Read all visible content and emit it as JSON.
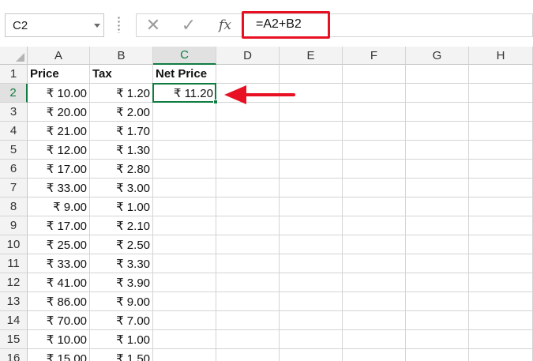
{
  "formula_bar": {
    "name_box": "C2",
    "formula": "=A2+B2",
    "fx_label": "fx"
  },
  "columns": [
    "A",
    "B",
    "C",
    "D",
    "E",
    "F",
    "G",
    "H"
  ],
  "rows": [
    "1",
    "2",
    "3",
    "4",
    "5",
    "6",
    "7",
    "8",
    "9",
    "10",
    "11",
    "12",
    "13",
    "14",
    "15",
    "16"
  ],
  "headers": {
    "price": "Price",
    "tax": "Tax",
    "net_price": "Net Price"
  },
  "data": [
    {
      "price": "₹ 10.00",
      "tax": "₹ 1.20",
      "net": "₹ 11.20"
    },
    {
      "price": "₹ 20.00",
      "tax": "₹ 2.00",
      "net": ""
    },
    {
      "price": "₹ 21.00",
      "tax": "₹ 1.70",
      "net": ""
    },
    {
      "price": "₹ 12.00",
      "tax": "₹ 1.30",
      "net": ""
    },
    {
      "price": "₹ 17.00",
      "tax": "₹ 2.80",
      "net": ""
    },
    {
      "price": "₹ 33.00",
      "tax": "₹ 3.00",
      "net": ""
    },
    {
      "price": "₹ 9.00",
      "tax": "₹ 1.00",
      "net": ""
    },
    {
      "price": "₹ 17.00",
      "tax": "₹ 2.10",
      "net": ""
    },
    {
      "price": "₹ 25.00",
      "tax": "₹ 2.50",
      "net": ""
    },
    {
      "price": "₹ 33.00",
      "tax": "₹ 3.30",
      "net": ""
    },
    {
      "price": "₹ 41.00",
      "tax": "₹ 3.90",
      "net": ""
    },
    {
      "price": "₹ 86.00",
      "tax": "₹ 9.00",
      "net": ""
    },
    {
      "price": "₹ 70.00",
      "tax": "₹ 7.00",
      "net": ""
    },
    {
      "price": "₹ 10.00",
      "tax": "₹ 1.00",
      "net": ""
    },
    {
      "price": "₹ 15.00",
      "tax": "₹ 1.50",
      "net": ""
    }
  ],
  "selection": {
    "column": "C",
    "row": "2"
  },
  "colors": {
    "accent": "#107c41",
    "highlight": "#e81123"
  },
  "icons": {
    "cancel": "close-icon",
    "enter": "checkmark-icon",
    "function": "fx-icon",
    "dropdown": "chevron-down-icon"
  }
}
